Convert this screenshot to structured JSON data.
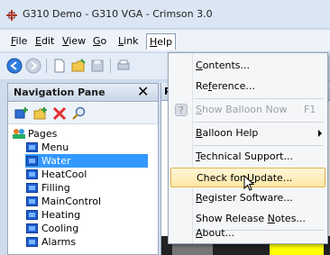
{
  "window": {
    "title": "G310 Demo - G310 VGA - Crimson 3.0"
  },
  "menubar": {
    "items": [
      {
        "label": "File",
        "key": "F"
      },
      {
        "label": "Edit",
        "key": "E"
      },
      {
        "label": "View",
        "key": "V"
      },
      {
        "label": "Go",
        "key": "G"
      },
      {
        "label": "Link",
        "key": "L"
      },
      {
        "label": "Help",
        "key": "H"
      }
    ]
  },
  "toolbar": {
    "icons": [
      "back-icon",
      "forward-icon",
      "new-icon",
      "open-icon",
      "save-icon",
      "print-icon"
    ]
  },
  "nav_pane": {
    "title": "Navigation Pane",
    "close_glyph": "✕",
    "tools": [
      "add-page-icon",
      "add-folder-icon",
      "delete-icon",
      "search-icon"
    ],
    "root_label": "Pages",
    "pages": [
      "Menu",
      "Water",
      "HeatCool",
      "Filling",
      "MainControl",
      "Heating",
      "Cooling",
      "Alarms"
    ],
    "selected_index": 1
  },
  "right_pane": {
    "header_text": "Pa"
  },
  "help_menu": {
    "items": [
      {
        "label_pre": "",
        "label_key": "C",
        "label_post": "ontents...",
        "disabled": false
      },
      {
        "label_pre": "Re",
        "label_key": "f",
        "label_post": "erence...",
        "disabled": false
      },
      {
        "label_pre": "",
        "label_key": "S",
        "label_post": "how Balloon Now",
        "shortcut": "F1",
        "disabled": true
      },
      {
        "label_pre": "",
        "label_key": "B",
        "label_post": "alloon Help",
        "submenu": true,
        "disabled": false
      },
      {
        "label_pre": "",
        "label_key": "T",
        "label_post": "echnical Support...",
        "disabled": false
      },
      {
        "label_pre": "Check for ",
        "label_key": "U",
        "label_post": "pdate...",
        "disabled": false,
        "hover": true
      },
      {
        "label_pre": "",
        "label_key": "R",
        "label_post": "egister Software...",
        "disabled": false
      },
      {
        "label_pre": "Show Release ",
        "label_key": "N",
        "label_post": "otes...",
        "disabled": false
      },
      {
        "label_pre": "",
        "label_key": "A",
        "label_post": "bout...",
        "disabled": false
      }
    ]
  },
  "colors": {
    "selection": "#3399ff",
    "hover_fill": "#ffe7a5",
    "hover_border": "#e2b44a"
  }
}
